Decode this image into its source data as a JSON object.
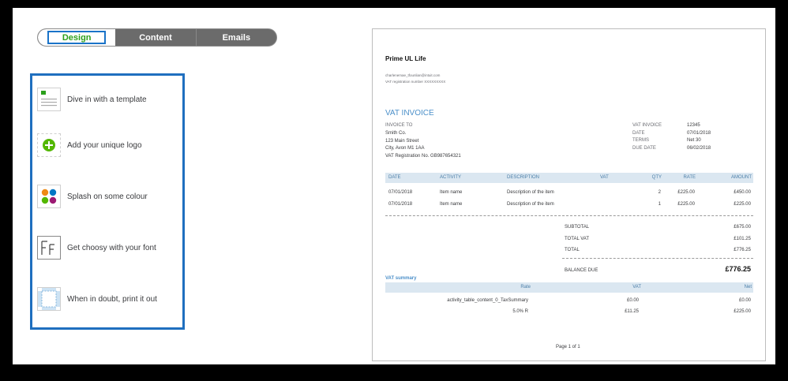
{
  "tabs": {
    "design": "Design",
    "content": "Content",
    "emails": "Emails"
  },
  "options": [
    {
      "label": "Dive in with a template",
      "icon": "template-icon"
    },
    {
      "label": "Add your unique logo",
      "icon": "add-logo-icon"
    },
    {
      "label": "Splash on some colour",
      "icon": "color-palette-icon"
    },
    {
      "label": "Get choosy with your font",
      "icon": "font-icon"
    },
    {
      "label": "When in doubt, print it out",
      "icon": "print-margins-icon"
    }
  ],
  "colors": {
    "accent_green": "#2ca01c",
    "accent_blue": "#1f6fbf",
    "invoice_blue": "#4b8fc9",
    "table_header": "#dbe7f1"
  },
  "invoice": {
    "company": "Prime UL Life",
    "email": "charlenemae_tfounlian@intuit.com",
    "vat_reg": "VAT registration number XXXXXXXXX",
    "title": "VAT INVOICE",
    "invoice_to_label": "INVOICE TO",
    "bill_to": [
      "Smith Co.",
      "123 Main Street",
      "City, Avon M1 1AA",
      "VAT Registration No. GB987654321"
    ],
    "meta": [
      {
        "label": "VAT INVOICE",
        "value": "12345"
      },
      {
        "label": "DATE",
        "value": "07/01/2018"
      },
      {
        "label": "TERMS",
        "value": "Net 30"
      },
      {
        "label": "DUE DATE",
        "value": "06/02/2018"
      }
    ],
    "columns": {
      "date": "DATE",
      "activity": "ACTIVITY",
      "description": "DESCRIPTION",
      "vat": "VAT",
      "qty": "QTY",
      "rate": "RATE",
      "amount": "AMOUNT"
    },
    "rows": [
      {
        "date": "07/01/2018",
        "activity": "Item name",
        "description": "Description of the item",
        "qty": "2",
        "rate": "£225.00",
        "amount": "£450.00"
      },
      {
        "date": "07/01/2018",
        "activity": "Item name",
        "description": "Description of the item",
        "qty": "1",
        "rate": "£225.00",
        "amount": "£225.00"
      }
    ],
    "subtotal_label": "SUBTOTAL",
    "subtotal": "£675.00",
    "total_vat_label": "TOTAL VAT",
    "total_vat": "£101.25",
    "total_label": "TOTAL",
    "total": "£776.25",
    "balance_label": "BALANCE DUE",
    "balance": "£776.25",
    "vat_summary_title": "VAT summary",
    "vat_summary_cols": {
      "rate": "Rate",
      "vat": "VAT",
      "net": "Net"
    },
    "vat_summary_rows": [
      {
        "rate": "activity_table_content_0_TaxSummary",
        "vat": "£0.00",
        "net": "£0.00"
      },
      {
        "rate": "5.0% R",
        "vat": "£11.25",
        "net": "£225.00"
      }
    ],
    "page": "Page 1 of 1"
  }
}
